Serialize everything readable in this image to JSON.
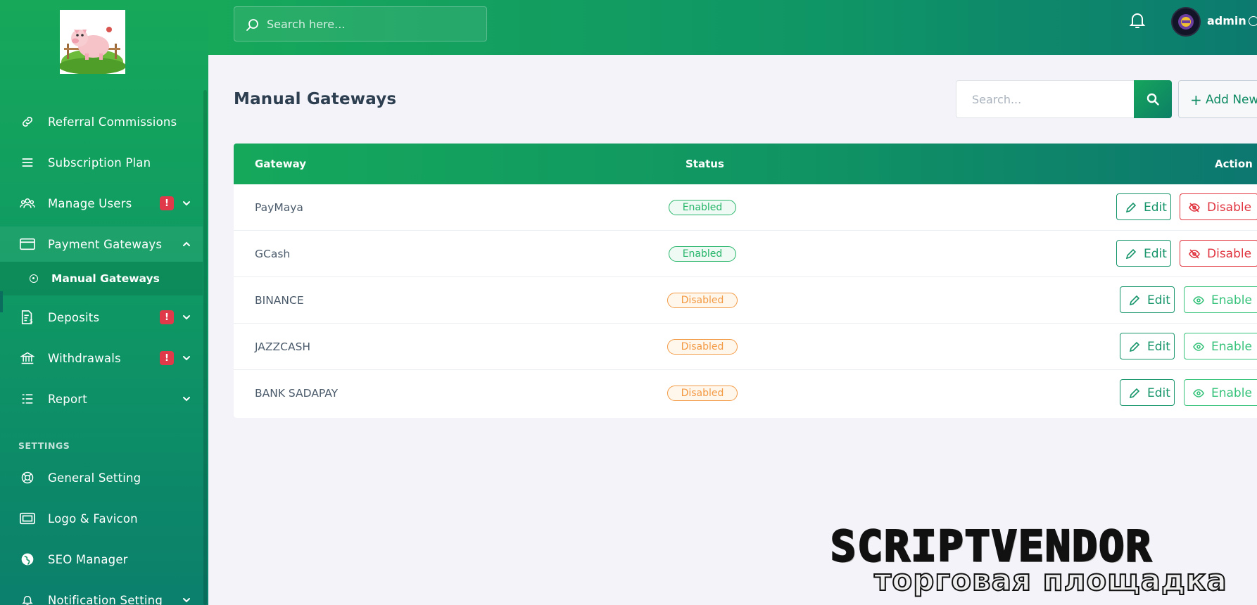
{
  "header": {
    "search_placeholder": "Search here...",
    "user_name": "admin"
  },
  "sidebar": {
    "items": [
      {
        "label": "Referral Commissions"
      },
      {
        "label": "Subscription Plan"
      },
      {
        "label": "Manage Users",
        "badge": "!"
      },
      {
        "label": "Payment Gateways"
      },
      {
        "label": "Deposits",
        "badge": "!"
      },
      {
        "label": "Withdrawals",
        "badge": "!"
      },
      {
        "label": "Report"
      }
    ],
    "sub_item": {
      "label": "Manual Gateways"
    },
    "section_label": "SETTINGS",
    "settings_items": [
      {
        "label": "General Setting"
      },
      {
        "label": "Logo & Favicon"
      },
      {
        "label": "SEO Manager"
      },
      {
        "label": "Notification Setting"
      }
    ]
  },
  "page": {
    "title": "Manual Gateways",
    "search_placeholder": "Search...",
    "add_new_label": "Add New"
  },
  "table": {
    "columns": [
      "Gateway",
      "Status",
      "Action"
    ],
    "rows": [
      {
        "gateway": "PayMaya",
        "status": "Enabled",
        "edit": "Edit",
        "toggle": "Disable"
      },
      {
        "gateway": "GCash",
        "status": "Enabled",
        "edit": "Edit",
        "toggle": "Disable"
      },
      {
        "gateway": "BINANCE",
        "status": "Disabled",
        "edit": "Edit",
        "toggle": "Enable"
      },
      {
        "gateway": "JAZZCASH",
        "status": "Disabled",
        "edit": "Edit",
        "toggle": "Enable"
      },
      {
        "gateway": "BANK SADAPAY",
        "status": "Disabled",
        "edit": "Edit",
        "toggle": "Enable"
      }
    ]
  },
  "watermark": {
    "line1": "SCRIPTVENDOR",
    "line2": "торговая площадка"
  },
  "colors": {
    "brand_green": "#17a85a",
    "brand_teal": "#0c7a6f",
    "enabled": "#26b56a",
    "disabled": "#f39a44",
    "danger": "#e0343f"
  }
}
